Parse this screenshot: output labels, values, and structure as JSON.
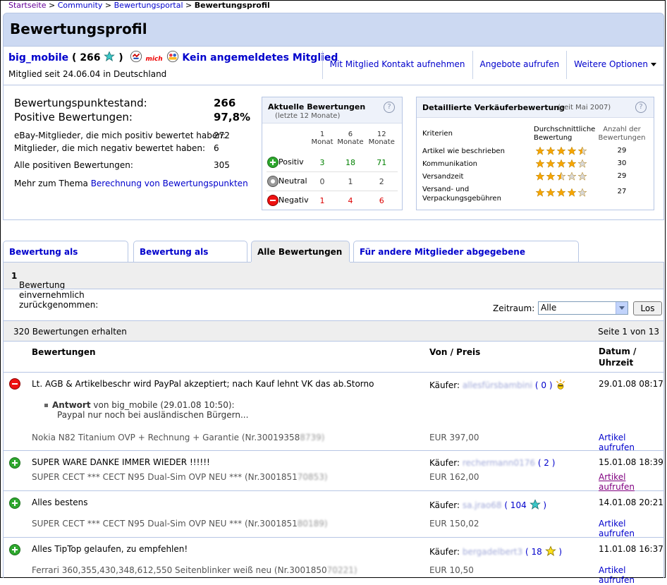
{
  "breadcrumb": {
    "home": "Startseite",
    "community": "Community",
    "portal": "Bewertungsportal",
    "current": "Bewertungsprofil",
    "sep": ">"
  },
  "page_title": "Bewertungsprofil",
  "member": {
    "username": "big_mobile",
    "score_open": "( 266",
    "score_close": ")",
    "me_label": "mich",
    "not_logged": "Kein angemeldetes Mitglied",
    "since": "Mitglied seit 24.06.04 in Deutschland",
    "links": {
      "contact": "Mit Mitglied Kontakt aufnehmen",
      "offers": "Angebote aufrufen",
      "more": "Weitere Optionen"
    }
  },
  "summary": {
    "points_label": "Bewertungspunktestand:",
    "points_value": "266",
    "positive_label": "Positive Bewertungen:",
    "positive_value": "97,8%",
    "members_pos_label": "eBay-Mitglieder, die mich positiv bewertet haben:",
    "members_pos_value": "272",
    "members_neg_label": "Mitglieder, die mich negativ bewertet haben:",
    "members_neg_value": "6",
    "all_pos_label": "Alle positiven Bewertungen:",
    "all_pos_value": "305",
    "more_prefix": "Mehr zum Thema",
    "more_link": "Berechnung von Bewertungspunkten"
  },
  "current_ratings": {
    "title": "Aktuelle Bewertungen",
    "subtitle": "(letzte 12 Monate)",
    "help": "?",
    "cols": [
      "1 Monat",
      "6 Monate",
      "12 Monate"
    ],
    "rows": [
      {
        "label": "Positiv",
        "values": [
          "3",
          "18",
          "71"
        ],
        "color": "#008000"
      },
      {
        "label": "Neutral",
        "values": [
          "0",
          "1",
          "2"
        ],
        "color": "#444444"
      },
      {
        "label": "Negativ",
        "values": [
          "1",
          "4",
          "6"
        ],
        "color": "#dd0000"
      }
    ]
  },
  "seller_rating": {
    "title": "Detaillierte Verkäuferbewertung",
    "since": "(seit Mai 2007)",
    "help": "?",
    "col_criteria": "Kriterien",
    "col_avg": "Durchschnittliche Bewertung",
    "col_count": "Anzahl der Bewertungen",
    "rows": [
      {
        "label": "Artikel wie beschrieben",
        "stars": 4.5,
        "count": "29"
      },
      {
        "label": "Kommunikation",
        "stars": 4,
        "count": "30"
      },
      {
        "label": "Versandzeit",
        "stars": 2.5,
        "count": "29"
      },
      {
        "label": "Versand- und Verpackungsgebühren",
        "stars": 4,
        "count": "27"
      }
    ]
  },
  "tabs": [
    "Bewertung als Verkäufer",
    "Bewertung als Käufer",
    "Alle Bewertungen",
    "Für andere Mitglieder abgegebene Bewertung"
  ],
  "withdrawn": {
    "label": "Bewertung einvernehmlich zurückgenommen:",
    "value": "1"
  },
  "filter": {
    "label": "Zeitraum:",
    "selected": "Alle",
    "button": "Los"
  },
  "count": {
    "received": "320 Bewertungen erhalten",
    "page": "Seite 1 von 13"
  },
  "table_head": {
    "ratings": "Bewertungen",
    "from": "Von / Preis",
    "date": "Datum /",
    "time": "Uhrzeit"
  },
  "entries": [
    {
      "type": "neg",
      "text": "Lt. AGB & Artikelbeschr wird PayPal akzeptiert; nach Kauf lehnt VK das ab.Storno",
      "buyer_prefix": "Käufer:",
      "buyer_name": "allesfürsbambini",
      "buyer_score": "( 0 )",
      "date": "29.01.08 08:17",
      "reply_title": "Antwort",
      "reply_meta": "von big_mobile (29.01.08 10:50):",
      "reply_text": "Paypal nur noch bei ausländischen Bürgern...",
      "item": "Nokia N82 Titanium OVP + Rechnung + Garantie (Nr.30019358",
      "item_hidden": "8739)",
      "price": "EUR 397,00",
      "link": "Artikel aufrufen"
    },
    {
      "type": "pos",
      "text": "SUPER WARE DANKE IMMER WIEDER !!!!!!",
      "buyer_prefix": "Käufer:",
      "buyer_name": "rechermann0176",
      "buyer_score": "( 2 )",
      "date": "15.01.08 18:39",
      "item": "SUPER CECT *** CECT N95 Dual-Sim OVP NEU *** (Nr.3001851",
      "item_hidden": "70853)",
      "price": "EUR 162,00",
      "link": "Artikel aufrufen"
    },
    {
      "type": "pos",
      "text": "Alles bestens",
      "buyer_prefix": "Käufer:",
      "buyer_name": "sa.jrao68",
      "buyer_score": "( 104",
      "buyer_score_close": ")",
      "date": "14.01.08 20:21",
      "item": "SUPER CECT *** CECT N95 Dual-Sim OVP NEU *** (Nr.3001851",
      "item_hidden": "80189)",
      "price": "EUR 150,02",
      "link": "Artikel aufrufen"
    },
    {
      "type": "pos",
      "text": "Alles TipTop gelaufen, zu empfehlen!",
      "buyer_prefix": "Käufer:",
      "buyer_name": "bergadelbert3",
      "buyer_score": "( 18",
      "buyer_score_close": ")",
      "date": "11.01.08 16:37",
      "item": "Ferrari 360,355,430,348,612,550 Seitenblinker weiß neu (Nr.3001850",
      "item_hidden": "70221)",
      "price": "EUR 10,50",
      "link": "Artikel aufrufen"
    }
  ]
}
